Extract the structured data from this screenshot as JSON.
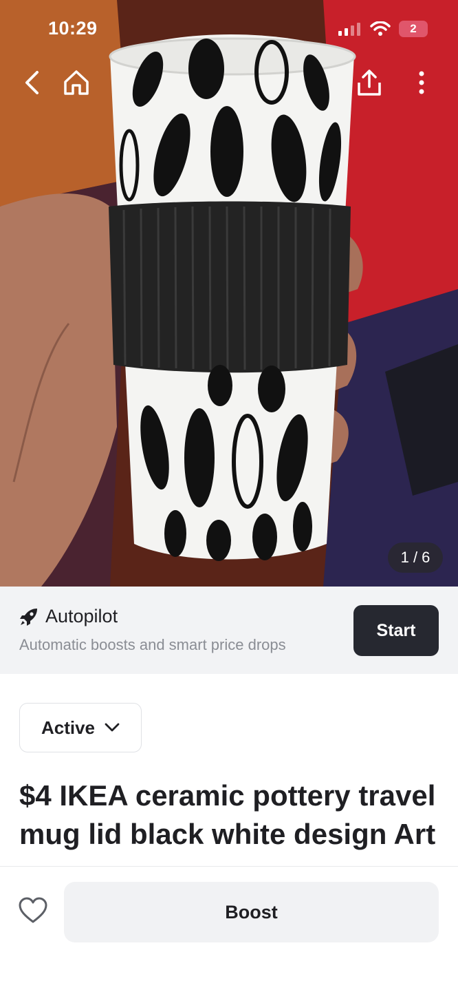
{
  "status_bar": {
    "time": "10:29",
    "battery_level": "2",
    "icons": [
      "cellular-signal-icon",
      "wifi-icon",
      "battery-icon"
    ]
  },
  "photo": {
    "description_icon": "travel-mug-photo",
    "counter": "1 / 6",
    "nav_icons": [
      "back-icon",
      "home-icon",
      "share-icon",
      "more-icon"
    ]
  },
  "autopilot": {
    "title": "Autopilot",
    "subtitle": "Automatic boosts and smart price drops",
    "button": "Start",
    "icon": "rocket-icon"
  },
  "listing": {
    "status": "Active",
    "title": "$4 IKEA ceramic pottery travel mug lid black white design Art"
  },
  "bottom_bar": {
    "boost_label": "Boost",
    "like_icon": "heart-icon"
  },
  "colors": {
    "start_button": "#262830",
    "battery_badge": "#e0566b",
    "banner_bg": "#f2f3f5"
  }
}
